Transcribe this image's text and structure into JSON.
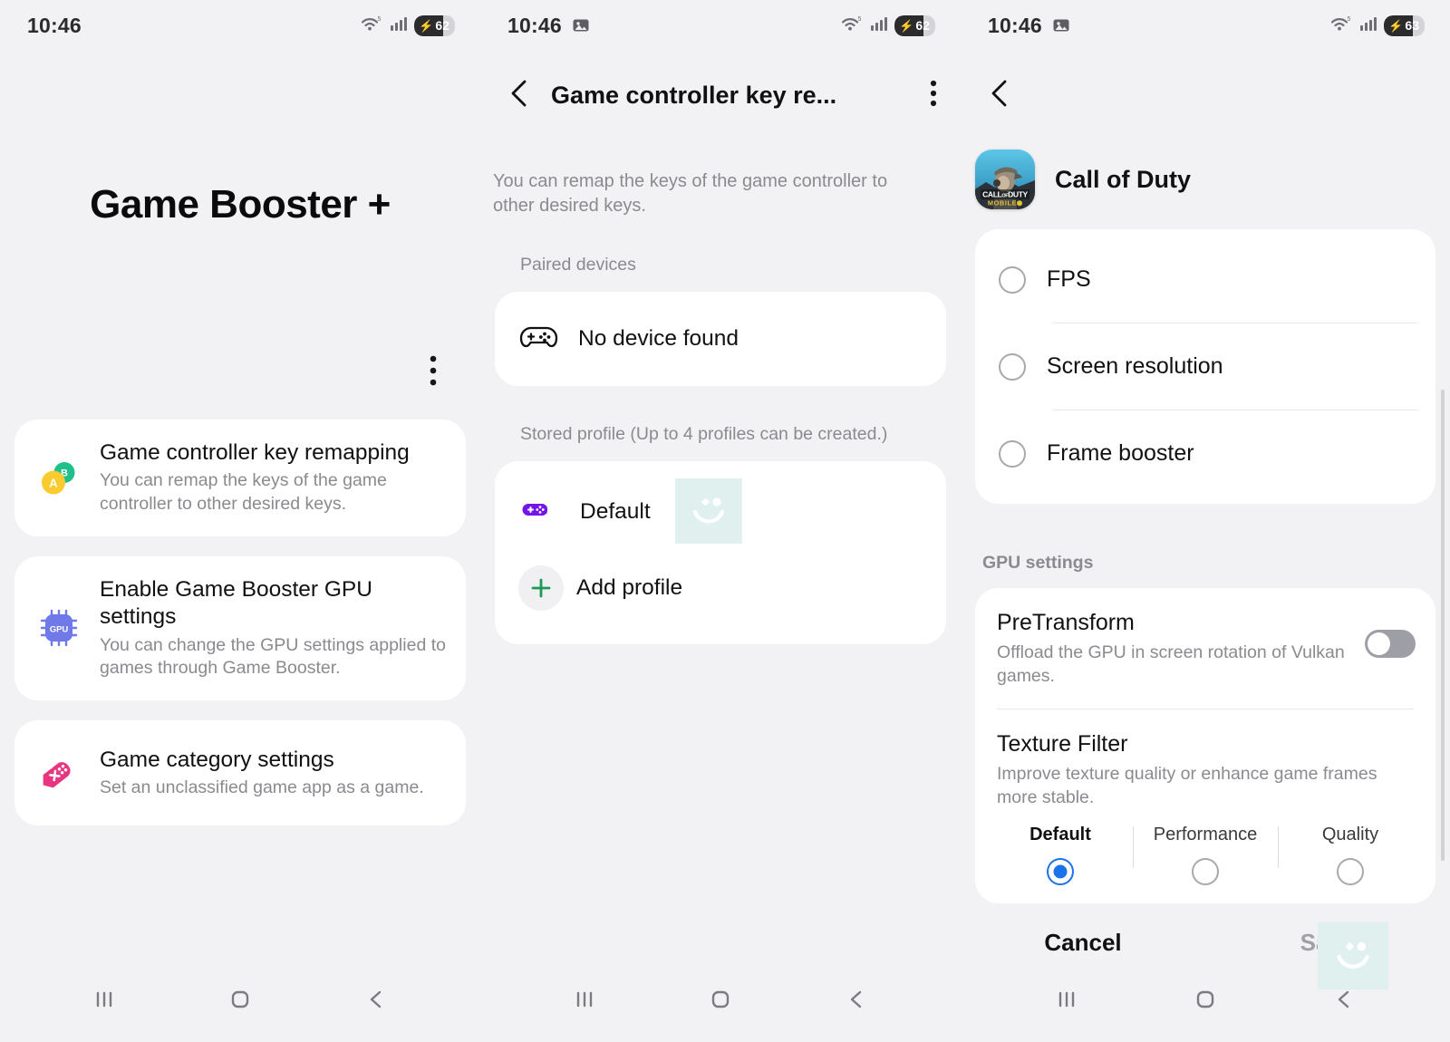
{
  "panels": [
    {
      "status": {
        "time": "10:46",
        "battery": "62",
        "has_image_icon": false,
        "charging": true
      },
      "title": "Game Booster +",
      "more_icon": "kebab-menu-icon",
      "cards": [
        {
          "icon": "ab-buttons-icon",
          "title": "Game controller key remapping",
          "desc": "You can remap the keys of the game controller to other desired keys."
        },
        {
          "icon": "gpu-chip-icon",
          "title": "Enable Game Booster GPU settings",
          "desc": "You can change the GPU settings applied to games through Game Booster."
        },
        {
          "icon": "game-tag-icon",
          "title": "Game category settings",
          "desc": "Set an unclassified game app as a game."
        }
      ]
    },
    {
      "status": {
        "time": "10:46",
        "battery": "62",
        "has_image_icon": true,
        "charging": true
      },
      "header": {
        "back_icon": "back-chevron-icon",
        "title": "Game controller key re...",
        "menu_icon": "kebab-menu-icon"
      },
      "subtitle": "You can remap the keys of the game controller to other desired keys.",
      "paired_label": "Paired devices",
      "paired_row": {
        "icon": "gamepad-outline-icon",
        "label": "No device found"
      },
      "stored_label": "Stored profile (Up to 4 profiles can be created.)",
      "profiles": [
        {
          "icon": "gamepad-purple-icon",
          "label": "Default"
        },
        {
          "icon": "plus-icon",
          "label": "Add profile"
        }
      ]
    },
    {
      "status": {
        "time": "10:46",
        "battery": "63",
        "has_image_icon": true,
        "charging": true
      },
      "back_icon": "back-chevron-icon",
      "app": {
        "icon": "call-of-duty-icon",
        "name": "Call of Duty"
      },
      "options": [
        {
          "label": "FPS",
          "selected": false
        },
        {
          "label": "Screen resolution",
          "selected": false
        },
        {
          "label": "Frame booster",
          "selected": false
        }
      ],
      "gpu_section_label": "GPU settings",
      "pretransform": {
        "title": "PreTransform",
        "desc": "Offload the GPU in screen rotation of Vulkan games.",
        "toggle_on": false
      },
      "texture_filter": {
        "title": "Texture Filter",
        "desc": "Improve texture quality or enhance game frames more stable.",
        "choices": [
          {
            "label": "Default",
            "selected": true
          },
          {
            "label": "Performance",
            "selected": false
          },
          {
            "label": "Quality",
            "selected": false
          }
        ]
      },
      "actions": {
        "cancel": "Cancel",
        "save": "Save"
      }
    }
  ],
  "navbar": {
    "recents_icon": "recents-icon",
    "home_icon": "home-icon",
    "back_icon": "back-icon"
  },
  "colors": {
    "background": "#f2f2f4",
    "card": "#ffffff",
    "accent_blue": "#1a73e8",
    "muted_text": "#8a8a90",
    "watermark": "#dff0ef"
  }
}
